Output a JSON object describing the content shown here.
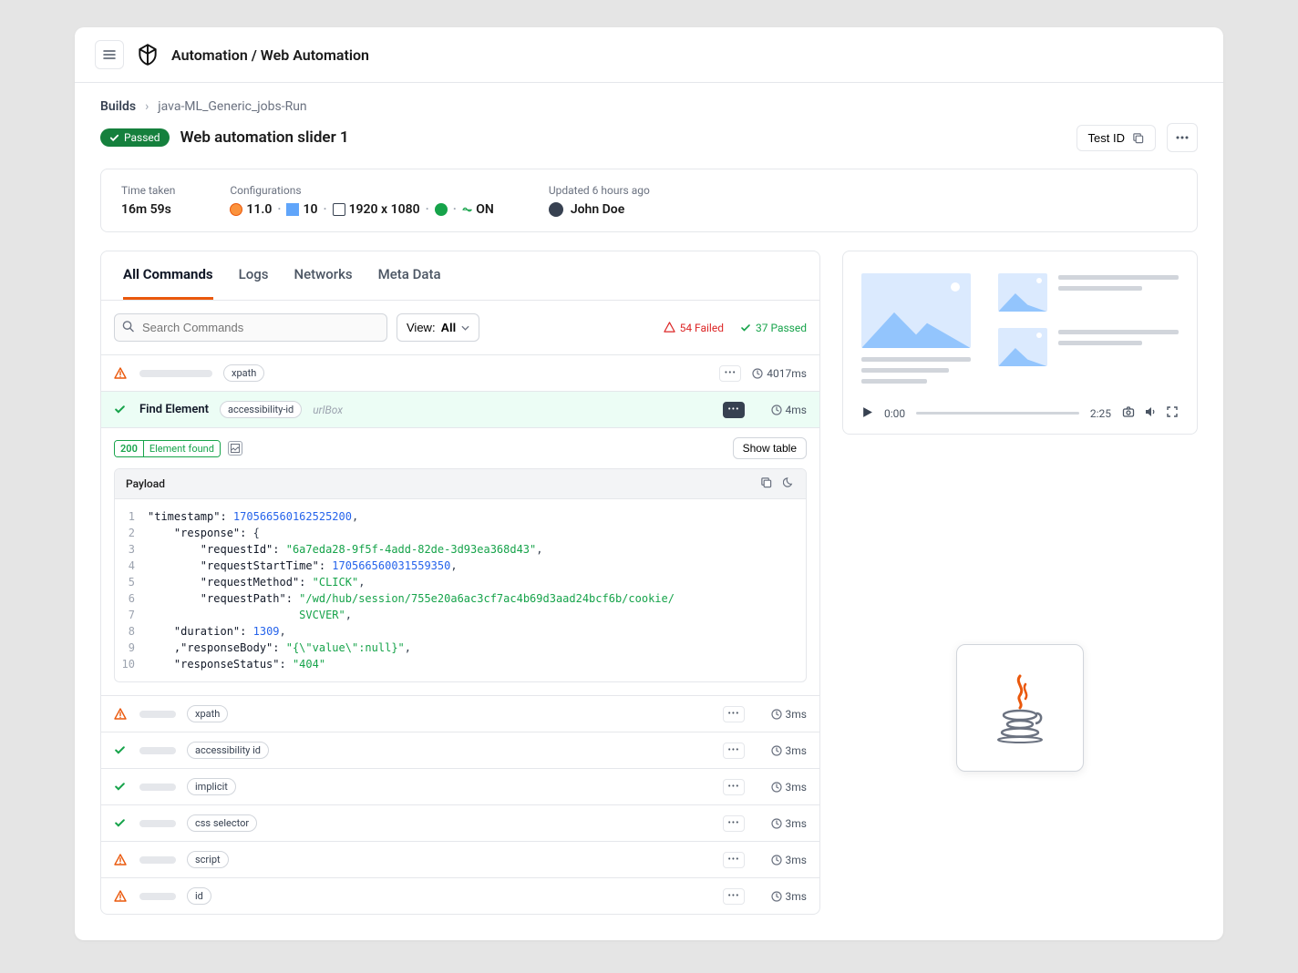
{
  "header": {
    "title": "Automation / Web Automation"
  },
  "breadcrumb": {
    "root": "Builds",
    "current": "java-ML_Generic_jobs-Run"
  },
  "titleRow": {
    "status": "Passed",
    "title": "Web automation slider 1",
    "testIdBtn": "Test ID"
  },
  "info": {
    "timeLbl": "Time taken",
    "timeVal": "16m 59s",
    "cfgLbl": "Configurations",
    "cfgVer": "11.0",
    "cfgCount": "10",
    "cfgRes": "1920 x 1080",
    "cfgOn": "ON",
    "updated": "Updated 6 hours ago",
    "user": "John Doe"
  },
  "tabs": {
    "all": "All Commands",
    "logs": "Logs",
    "net": "Networks",
    "meta": "Meta Data"
  },
  "search": {
    "placeholder": "Search Commands",
    "viewLbl": "View:",
    "viewVal": "All",
    "failed": "54 Failed",
    "passed": "37 Passed"
  },
  "rows": [
    {
      "status": "warn",
      "label": "xpath",
      "time": "4017ms"
    }
  ],
  "expandedRow": {
    "name": "Find Element",
    "pill": "accessibility-id",
    "param": "urlBox",
    "time": "4ms"
  },
  "detail": {
    "code": "200",
    "msg": "Element found",
    "showTable": "Show table"
  },
  "payload": {
    "title": "Payload"
  },
  "code": [
    {
      "n": "1",
      "pre": "",
      "k": "\"timestamp\":",
      "v": " 170566560162525200",
      "t": "num",
      "post": ","
    },
    {
      "n": "2",
      "pre": "    ",
      "k": "\"response\":",
      "v": " {",
      "t": "plain",
      "post": ""
    },
    {
      "n": "3",
      "pre": "        ",
      "k": "\"requestId\":",
      "v": " \"6a7eda28-9f5f-4add-82de-3d93ea368d43\"",
      "t": "str",
      "post": ","
    },
    {
      "n": "4",
      "pre": "        ",
      "k": "\"requestStartTime\":",
      "v": " 170566560031559350",
      "t": "num",
      "post": ","
    },
    {
      "n": "5",
      "pre": "        ",
      "k": "\"requestMethod\":",
      "v": " \"CLICK\"",
      "t": "str",
      "post": ","
    },
    {
      "n": "6",
      "pre": "        ",
      "k": "\"requestPath\":",
      "v": " \"/wd/hub/session/755e20a6ac3cf7ac4b69d3aad24bcf6b/cookie/",
      "t": "str",
      "post": ""
    },
    {
      "n": "7",
      "pre": "                       ",
      "k": "",
      "v": "SVCVER\"",
      "t": "str",
      "post": ","
    },
    {
      "n": "8",
      "pre": "    ",
      "k": "\"duration\":",
      "v": " 1309",
      "t": "num",
      "post": ","
    },
    {
      "n": "9",
      "pre": "    ",
      "k": ",\"responseBody\":",
      "v": " \"{\\\"value\\\":null}\"",
      "t": "str",
      "post": ","
    },
    {
      "n": "10",
      "pre": "    ",
      "k": "\"responseStatus\":",
      "v": " \"404\"",
      "t": "str",
      "post": ""
    }
  ],
  "moreRows": [
    {
      "status": "warn",
      "label": "xpath",
      "time": "3ms"
    },
    {
      "status": "ok",
      "label": "accessibility id",
      "time": "3ms"
    },
    {
      "status": "ok",
      "label": "implicit",
      "time": "3ms"
    },
    {
      "status": "ok",
      "label": "css selector",
      "time": "3ms"
    },
    {
      "status": "warn",
      "label": "script",
      "time": "3ms"
    },
    {
      "status": "warn",
      "label": "id",
      "time": "3ms"
    }
  ],
  "player": {
    "start": "0:00",
    "end": "2:25"
  }
}
